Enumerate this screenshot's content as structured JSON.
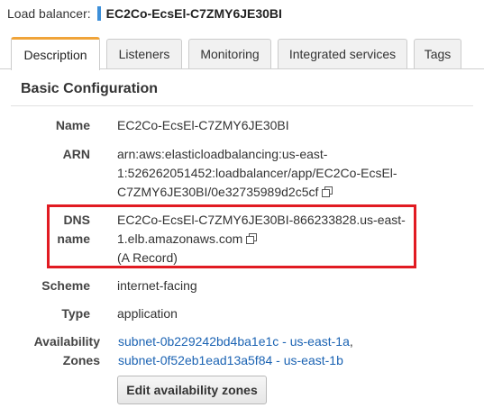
{
  "header": {
    "label": "Load balancer:",
    "value": "EC2Co-EcsEl-C7ZMY6JE30BI"
  },
  "tabs": [
    {
      "label": "Description",
      "active": true
    },
    {
      "label": "Listeners",
      "active": false
    },
    {
      "label": "Monitoring",
      "active": false
    },
    {
      "label": "Integrated services",
      "active": false
    },
    {
      "label": "Tags",
      "active": false
    }
  ],
  "section": {
    "title": "Basic Configuration"
  },
  "fields": {
    "name": {
      "label": "Name",
      "value": "EC2Co-EcsEl-C7ZMY6JE30BI"
    },
    "arn": {
      "label": "ARN",
      "lines": [
        "arn:aws:elasticloadbalancing:us-east-",
        "1:526262051452:loadbalancer/app/EC2Co-EcsEl-",
        "C7ZMY6JE30BI/0e32735989d2c5cf"
      ]
    },
    "dns": {
      "label_line1": "DNS",
      "label_line2": "name",
      "lines": [
        "EC2Co-EcsEl-C7ZMY6JE30BI-866233828.us-east-",
        "1.elb.amazonaws.com",
        "(A Record)"
      ]
    },
    "scheme": {
      "label": "Scheme",
      "value": "internet-facing"
    },
    "type": {
      "label": "Type",
      "value": "application"
    },
    "zones": {
      "label_line1": "Availability",
      "label_line2": "Zones",
      "items": [
        "subnet-0b229242bd4ba1e1c - us-east-1a",
        "subnet-0f52eb1ead13a5f84 - us-east-1b"
      ],
      "separator": ","
    }
  },
  "buttons": {
    "edit_zones": "Edit availability zones"
  },
  "colors": {
    "accent_tab": "#f0a43a",
    "header_bar": "#3d8fd9",
    "highlight": "#e11b22",
    "link": "#1b63b3"
  }
}
